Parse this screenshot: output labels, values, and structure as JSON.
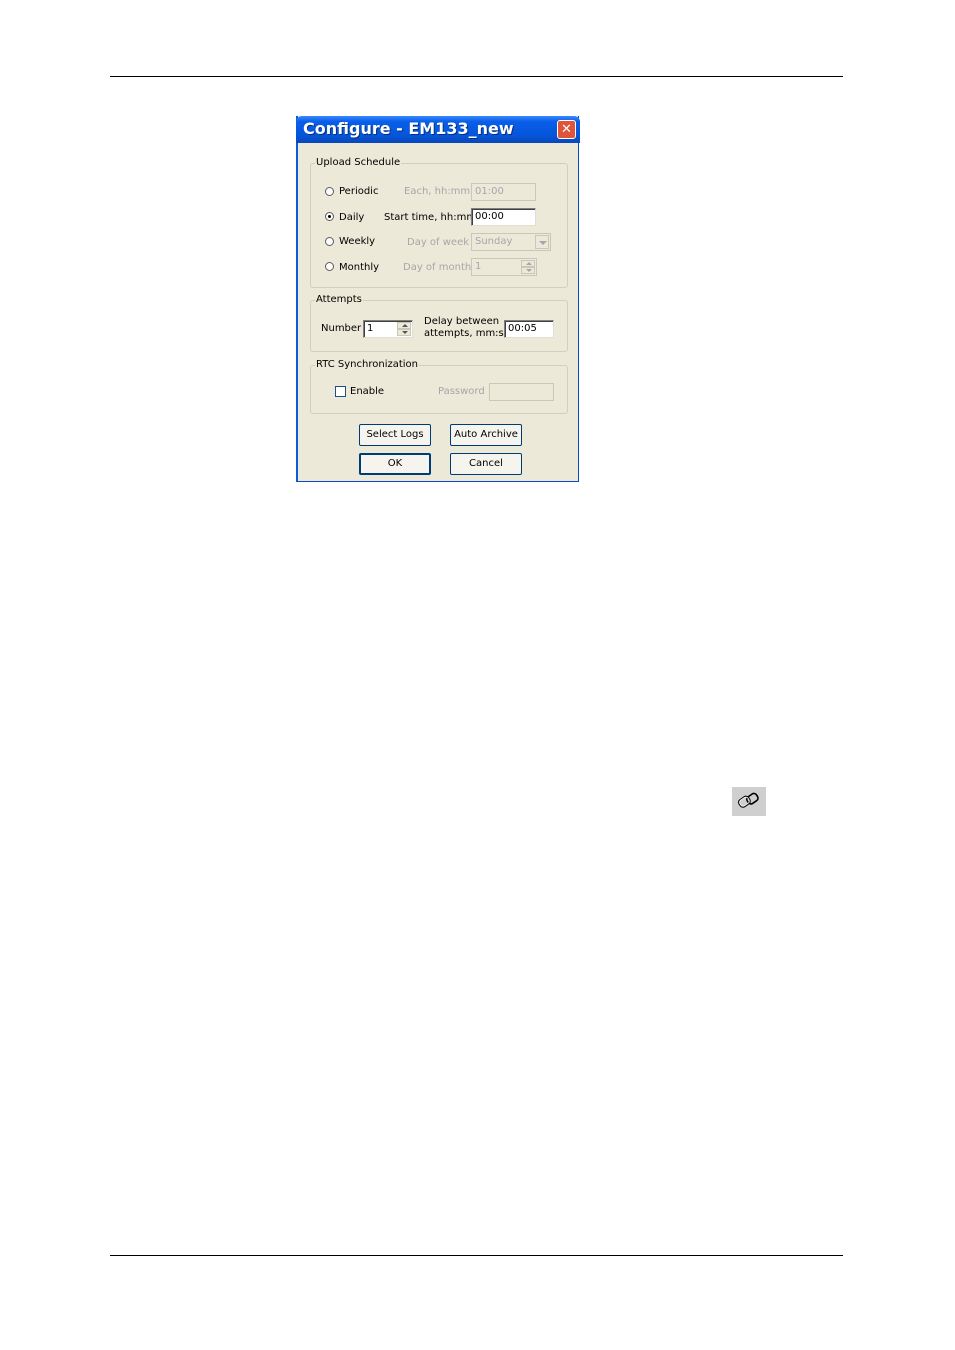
{
  "dialog": {
    "title": "Configure - EM133_new",
    "close_glyph": "✕",
    "upload_schedule": {
      "title": "Upload Schedule",
      "options": [
        {
          "label": "Periodic",
          "field_label": "Each, hh:mm",
          "value": "01:00",
          "selected": false,
          "enabled": false
        },
        {
          "label": "Daily",
          "field_label": "Start time, hh:mm",
          "value": "00:00",
          "selected": true,
          "enabled": true
        },
        {
          "label": "Weekly",
          "field_label": "Day of week",
          "value": "Sunday",
          "selected": false,
          "enabled": false
        },
        {
          "label": "Monthly",
          "field_label": "Day of month",
          "value": "1",
          "selected": false,
          "enabled": false
        }
      ]
    },
    "attempts": {
      "title": "Attempts",
      "number_label": "Number",
      "number_value": "1",
      "delay_label_line1": "Delay between",
      "delay_label_line2": "attempts, mm:ss",
      "delay_value": "00:05"
    },
    "rtc": {
      "title": "RTC Synchronization",
      "enable_label": "Enable",
      "enable_checked": false,
      "password_label": "Password",
      "password_value": ""
    },
    "buttons": {
      "select_logs": "Select Logs",
      "auto_archive": "Auto Archive",
      "ok": "OK",
      "cancel": "Cancel"
    }
  },
  "toolbar_icon": {
    "icon": "chain-link-icon"
  },
  "colors": {
    "titlebar": "#0556dc",
    "dialog_bg": "#ece9d8",
    "close": "#e0553a"
  }
}
